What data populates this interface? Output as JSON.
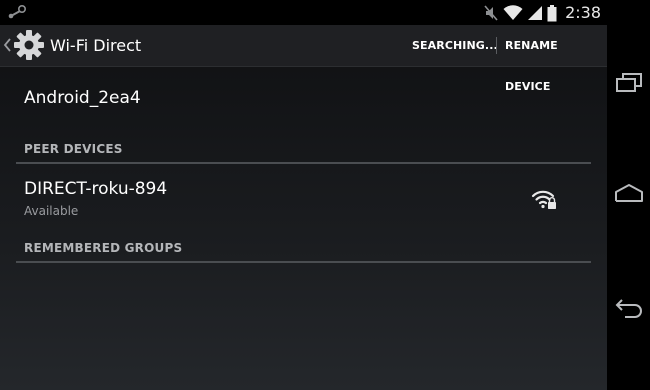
{
  "status_bar": {
    "time": "2:38",
    "icons": [
      "steam-icon",
      "mute-icon",
      "wifi-icon",
      "signal-icon",
      "battery-icon"
    ]
  },
  "action_bar": {
    "title": "Wi-Fi Direct",
    "searching_label": "SEARCHING...",
    "rename_label": "RENAME DEVICE",
    "icons": [
      "up-caret-icon",
      "settings-gear-icon"
    ]
  },
  "this_device": {
    "name": "Android_2ea4"
  },
  "sections": {
    "peer_devices": "PEER DEVICES",
    "remembered_groups": "REMEMBERED GROUPS"
  },
  "peers": [
    {
      "name": "DIRECT-roku-894",
      "status": "Available",
      "icon": "wifi-locked-icon"
    }
  ],
  "nav_bar": {
    "icons": [
      "recent-apps-icon",
      "home-icon",
      "back-icon"
    ]
  },
  "colors": {
    "accent": "#ffffff",
    "background_top": "#0e0f11",
    "background_bottom": "#24272b",
    "section_header": "#b4b6b9"
  }
}
